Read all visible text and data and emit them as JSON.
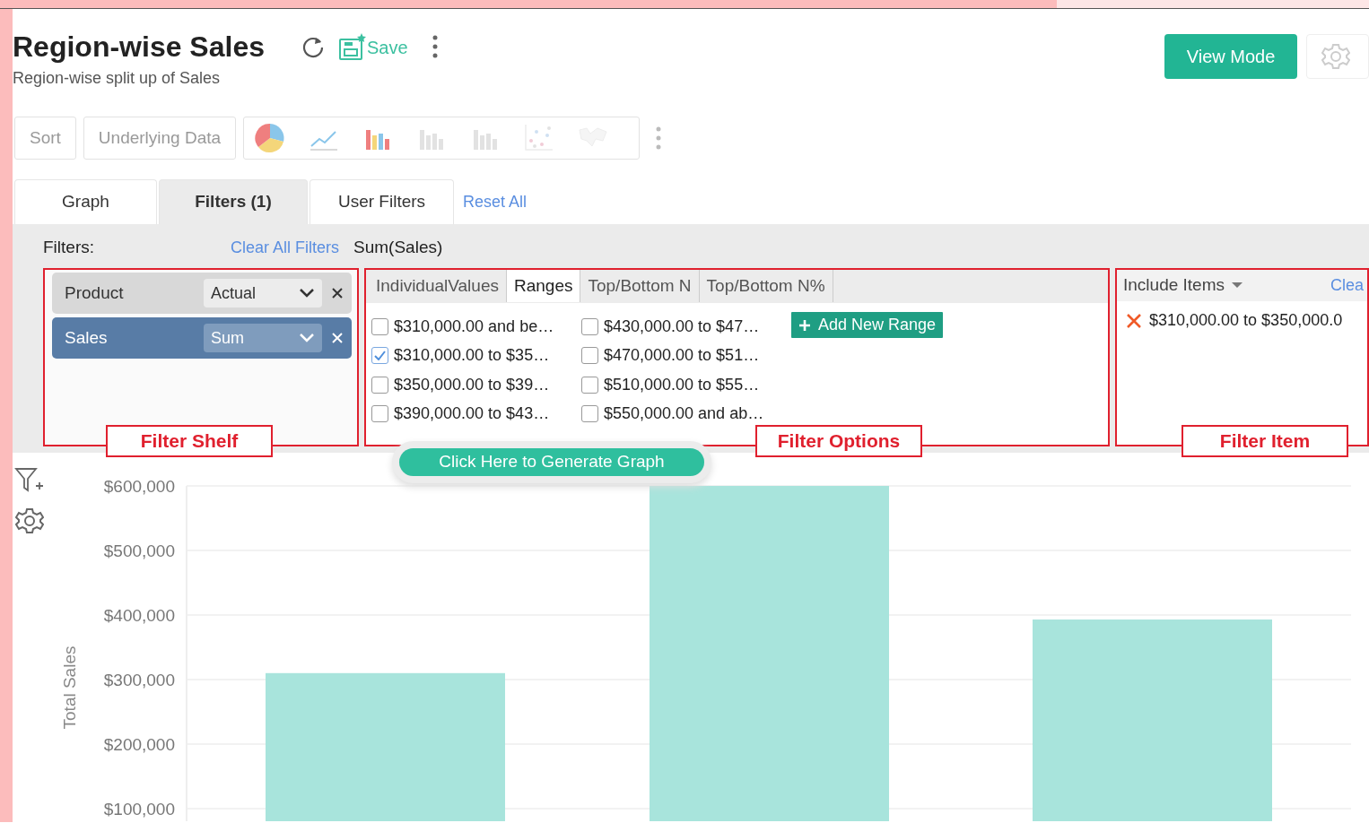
{
  "header": {
    "title": "Region-wise Sales",
    "save_label": "Save",
    "subtitle": "Region-wise split up of Sales",
    "view_mode_button": "View Mode"
  },
  "toolbar": {
    "buttons": [
      "Sort",
      "Underlying Data"
    ],
    "chart_types": [
      {
        "kind": "pie",
        "disabled": false
      },
      {
        "kind": "line",
        "disabled": false
      },
      {
        "kind": "bar",
        "disabled": false
      },
      {
        "kind": "bar",
        "disabled": true
      },
      {
        "kind": "bar",
        "disabled": true
      },
      {
        "kind": "scatter",
        "disabled": true
      },
      {
        "kind": "map",
        "disabled": true
      }
    ]
  },
  "tabs": [
    {
      "label": "Graph",
      "selected": false
    },
    {
      "label": "Filters (1)",
      "selected": true
    },
    {
      "label": "User Filters",
      "selected": false
    }
  ],
  "reset_all": "Reset All",
  "filters": {
    "label": "Filters:",
    "clear_all": "Clear All Filters",
    "current_filter": "Sum(Sales)",
    "shelf": [
      {
        "field": "Product",
        "aggregate": "Actual",
        "selected": false
      },
      {
        "field": "Sales",
        "aggregate": "Sum",
        "selected": true
      }
    ],
    "option_tabs": [
      {
        "label": "IndividualValues",
        "selected": false
      },
      {
        "label": "Ranges",
        "selected": true
      },
      {
        "label": "Top/Bottom N",
        "selected": false
      },
      {
        "label": "Top/Bottom N%",
        "selected": false
      }
    ],
    "options": [
      {
        "label": "$310,000.00 and be…",
        "checked": false
      },
      {
        "label": "$310,000.00 to $35…",
        "checked": true
      },
      {
        "label": "$350,000.00 to $39…",
        "checked": false
      },
      {
        "label": "$390,000.00 to $43…",
        "checked": false
      },
      {
        "label": "$430,000.00 to $47…",
        "checked": false
      },
      {
        "label": "$470,000.00 to $51…",
        "checked": false
      },
      {
        "label": "$510,000.00 to $55…",
        "checked": false
      },
      {
        "label": "$550,000.00 and ab…",
        "checked": false
      }
    ],
    "add_range_button": "Add New Range",
    "include_menu": "Include Items",
    "clear_link": "Clea",
    "included_items": [
      "$310,000.00 to $350,000.0"
    ]
  },
  "annotations": [
    "Filter Shelf",
    "Filter Options",
    "Filter Item"
  ],
  "generate_button": "Click Here to Generate Graph",
  "chart": {
    "chart_data": {
      "type": "bar",
      "ylabel": "Total Sales",
      "ylim": [
        80000,
        600000
      ],
      "grid": true,
      "values": [
        310000,
        600000,
        393000
      ],
      "yticks": [
        {
          "value": 600000,
          "label": "$600,000"
        },
        {
          "value": 500000,
          "label": "$500,000"
        },
        {
          "value": 400000,
          "label": "$400,000"
        },
        {
          "value": 300000,
          "label": "$300,000"
        },
        {
          "value": 200000,
          "label": "$200,000"
        },
        {
          "value": 100000,
          "label": "$100,000"
        }
      ]
    }
  }
}
